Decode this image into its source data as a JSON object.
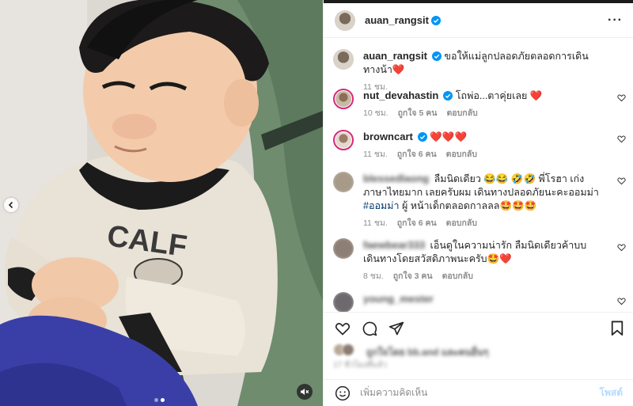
{
  "post": {
    "username": "auan_rangsit",
    "caption": "ขอให้แม่ลูกปลอดภัยตลอดการเดินทางน้า❤️",
    "caption_time": "11 ชม."
  },
  "comments": [
    {
      "username": "nut_devahastin",
      "text": "โถพ่อ...ตาคุ่ยเลย ❤️",
      "time": "10 ชม.",
      "likes": "ถูกใจ 5 คน",
      "reply": "ตอบกลับ"
    },
    {
      "username": "browncart",
      "text": "❤️❤️❤️",
      "time": "11 ชม.",
      "likes": "ถูกใจ 6 คน",
      "reply": "ตอบกลับ"
    },
    {
      "username": "blessedlaong",
      "text_before": "ลืมนิดเดียว 😂😂 🤣🤣 พี่โรฮา เก่ง ภาษาไทยมาก เลยครับผม เดินทางปลอดภัยนะคะออมม่า ",
      "hashtag": "#ออมม่า",
      "text_after": " ผู้ หน้าเด็กตลอดกาลลล🤩🤩🤩",
      "time": "11 ชม.",
      "likes": "ถูกใจ 6 คน",
      "reply": "ตอบกลับ"
    },
    {
      "username": "faewbear333",
      "text": "เอ็นดูในความน่ารัก ลืมนิดเดียวค้าบบ เดินทางโดยสวัสดิภาพนะครับ🤩❤️",
      "time": "8 ชม.",
      "likes": "ถูกใจ 3 คน",
      "reply": "ตอบกลับ"
    },
    {
      "username": "young_mester",
      "text": ""
    }
  ],
  "likes": {
    "text": "ถูกใจโดย bb.and และคนอื่นๆ",
    "date": "17 ชั่วโมงที่แล้ว"
  },
  "add_comment": {
    "placeholder": "เพิ่มความคิดเห็น",
    "post_label": "โพสต์"
  },
  "colors": {
    "link": "#00376b",
    "muted": "#8e8e8e",
    "verified": "#0095f6",
    "heart": "#ed1a3b",
    "post_button": "#b3dbff"
  },
  "media": {
    "carousel_total": 2,
    "carousel_active": 2
  }
}
